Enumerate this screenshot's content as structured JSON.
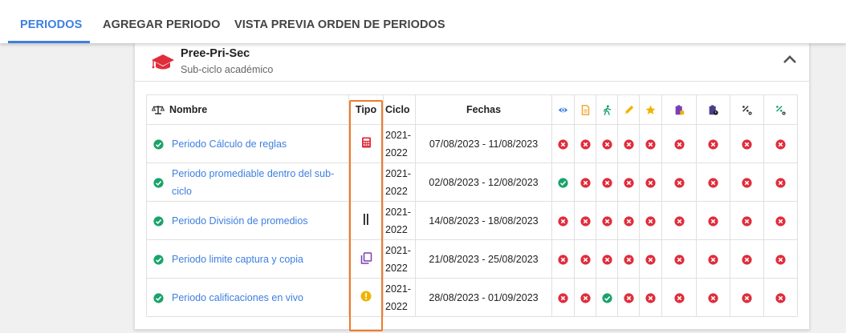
{
  "tabs": [
    {
      "label": "PERIODOS",
      "active": true
    },
    {
      "label": "AGREGAR PERIODO",
      "active": false
    },
    {
      "label": "VISTA PREVIA ORDEN DE PERIODOS",
      "active": false
    }
  ],
  "card": {
    "title": "Pree-Pri-Sec",
    "subtitle": "Sub-ciclo académico",
    "icon": "graduation-cap-icon",
    "collapse_icon": "chevron-up-icon"
  },
  "table": {
    "headers": {
      "nombre": "Nombre",
      "tipo": "Tipo",
      "ciclo": "Ciclo",
      "fechas": "Fechas"
    },
    "flag_columns": [
      {
        "icon": "eye-icon",
        "color": "#3d7fe0"
      },
      {
        "icon": "document-icon",
        "color": "#f0a020"
      },
      {
        "icon": "walking-person-icon",
        "color": "#1aa36a"
      },
      {
        "icon": "pencil-icon",
        "color": "#f0b400"
      },
      {
        "icon": "star-icon",
        "color": "#f0b400"
      },
      {
        "icon": "clipboard-add-icon",
        "color": "#7b3fb5"
      },
      {
        "icon": "clipboard-clock-icon",
        "color": "#4a3d8c"
      },
      {
        "icon": "percent-settings-icon",
        "color": "#333333"
      },
      {
        "icon": "percent-settings-green-icon",
        "color": "#1aa36a"
      }
    ],
    "rows": [
      {
        "name": "Periodo Cálculo de reglas",
        "tipo_icon": "calculator-icon",
        "ciclo": [
          "2021-",
          "2022"
        ],
        "fechas": "07/08/2023 - 11/08/2023",
        "flags": [
          false,
          false,
          false,
          false,
          false,
          false,
          false,
          false,
          false
        ]
      },
      {
        "name": "Periodo promediable dentro del sub-ciclo",
        "tipo_icon": "",
        "ciclo": [
          "2021-",
          "2022"
        ],
        "fechas": "02/08/2023 - 12/08/2023",
        "flags": [
          true,
          false,
          false,
          false,
          false,
          false,
          false,
          false,
          false
        ]
      },
      {
        "name": "Periodo División de promedios",
        "tipo_icon": "pause-bars-icon",
        "ciclo": [
          "2021-",
          "2022"
        ],
        "fechas": "14/08/2023 - 18/08/2023",
        "flags": [
          false,
          false,
          false,
          false,
          false,
          false,
          false,
          false,
          false
        ]
      },
      {
        "name": "Periodo limite captura y copia",
        "tipo_icon": "copy-icon",
        "ciclo": [
          "2021-",
          "2022"
        ],
        "fechas": "21/08/2023 - 25/08/2023",
        "flags": [
          false,
          false,
          false,
          false,
          false,
          false,
          false,
          false,
          false
        ]
      },
      {
        "name": "Periodo calificaciones en vivo",
        "tipo_icon": "alert-circle-icon",
        "ciclo": [
          "2021-",
          "2022"
        ],
        "fechas": "28/08/2023 - 01/09/2023",
        "flags": [
          false,
          false,
          true,
          false,
          false,
          false,
          false,
          false,
          false
        ]
      }
    ]
  },
  "colors": {
    "accent": "#3d7fe0",
    "ok": "#1aa36a",
    "no": "#e02d3c",
    "highlight": "#f07a2a"
  }
}
